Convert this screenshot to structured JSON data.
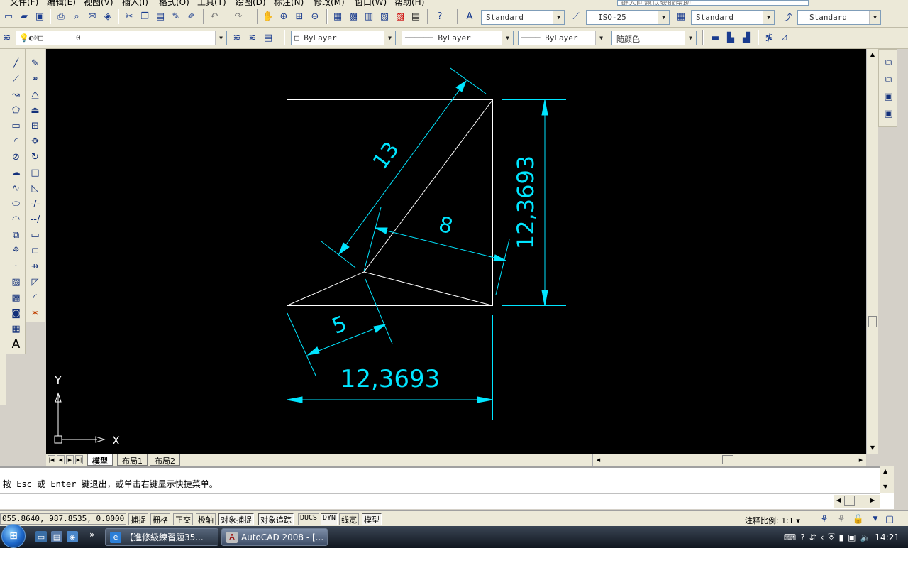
{
  "menu": {
    "items": [
      "文件(F)",
      "编辑(E)",
      "视图(V)",
      "插入(I)",
      "格式(O)",
      "工具(T)",
      "绘图(D)",
      "标注(N)",
      "修改(M)",
      "窗口(W)",
      "帮助(H)"
    ],
    "help_search_placeholder": "键入问题以获取帮助"
  },
  "styles_toolbar": {
    "text_style": "Standard",
    "dim_style": "ISO-25",
    "table_style": "Standard",
    "multileader_style": "Standard"
  },
  "layers_toolbar": {
    "current_layer": "0",
    "color": "ByLayer",
    "linetype": "ByLayer",
    "lineweight": "ByLayer",
    "plot_style": "随颜色"
  },
  "drawing": {
    "dimensions": {
      "hypotenuse": "13",
      "inner": "8",
      "short": "5",
      "vertical": "12,3693",
      "horizontal": "12,3693"
    },
    "ucs": {
      "x_label": "X",
      "y_label": "Y"
    },
    "colors": {
      "geometry": "#ffffff",
      "dimension": "#00e5ff",
      "background": "#000000"
    }
  },
  "layout_tabs": [
    "模型",
    "布局1",
    "布局2"
  ],
  "command": {
    "prompt": "按 Esc 或 Enter 键退出，或单击右键显示快捷菜单。",
    "input": ""
  },
  "status": {
    "coords": "055.8640, 987.8535, 0.0000",
    "toggles": [
      {
        "label": "捕捉",
        "on": false
      },
      {
        "label": "栅格",
        "on": false
      },
      {
        "label": "正交",
        "on": false
      },
      {
        "label": "极轴",
        "on": false
      },
      {
        "label": "对象捕捉",
        "on": true
      },
      {
        "label": "对象追踪",
        "on": true
      },
      {
        "label": "DUCS",
        "on": false
      },
      {
        "label": "DYN",
        "on": true
      },
      {
        "label": "线宽",
        "on": false
      },
      {
        "label": "模型",
        "on": true
      }
    ],
    "annotation_scale_label": "注释比例:",
    "annotation_scale": "1:1"
  },
  "taskbar": {
    "buttons": [
      {
        "label": "【進修級練習題35...",
        "icon": "ie-icon"
      },
      {
        "label": "AutoCAD 2008 - [...",
        "icon": "autocad-icon"
      }
    ],
    "clock": "14:21"
  }
}
